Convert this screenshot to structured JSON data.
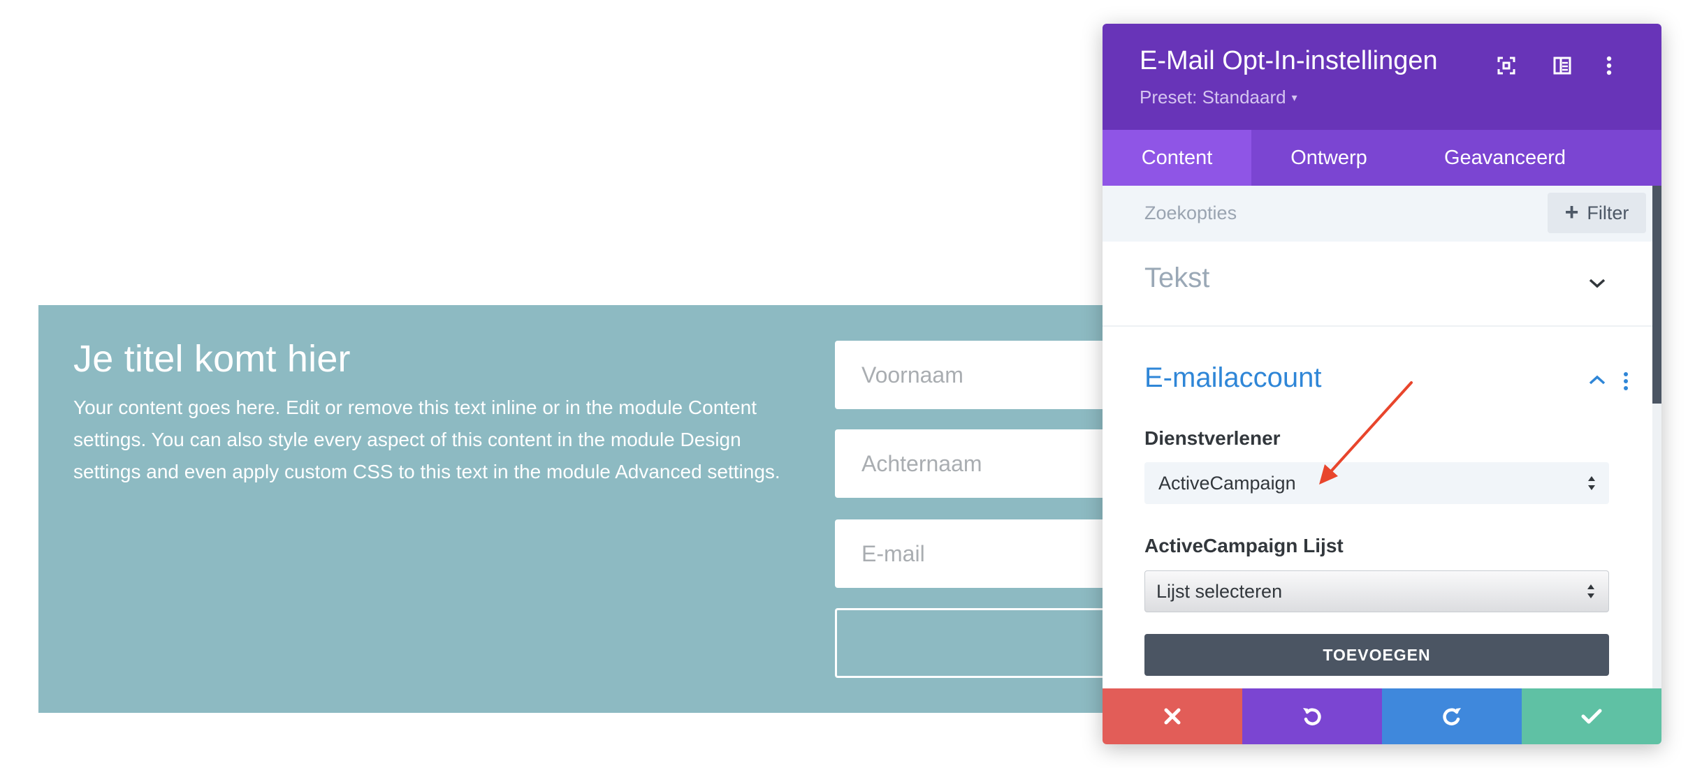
{
  "module": {
    "title": "Je titel komt hier",
    "body": "Your content goes here. Edit or remove this text inline or in the module Content settings. You can also style every aspect of this content in the module Design settings and even apply custom CSS to this text in the module Advanced settings.",
    "fields": {
      "first_name": "Voornaam",
      "last_name": "Achternaam",
      "email": "E-mail"
    }
  },
  "panel": {
    "title": "E-Mail Opt-In-instellingen",
    "preset": "Preset: Standaard",
    "header_icons": [
      "expand-icon",
      "layout-icon",
      "more-vertical-icon"
    ],
    "tabs": [
      {
        "label": "Content",
        "active": true
      },
      {
        "label": "Ontwerp",
        "active": false
      },
      {
        "label": "Geavanceerd",
        "active": false
      }
    ],
    "search": {
      "placeholder": "Zoekopties",
      "filter_label": "Filter"
    },
    "sections": {
      "tekst": {
        "label": "Tekst",
        "expanded": false
      },
      "email_account": {
        "label": "E-mailaccount",
        "expanded": true,
        "provider_label": "Dienstverlener",
        "provider_value": "ActiveCampaign",
        "list_label": "ActiveCampaign Lijst",
        "list_value": "Lijst selecteren",
        "add_button": "TOEVOEGEN"
      }
    },
    "footer": [
      "close-icon",
      "undo-icon",
      "redo-icon",
      "check-icon"
    ]
  },
  "colors": {
    "section_bg": "#8dbac2",
    "header_purple": "#6834b8",
    "tab_purple": "#7b45d2",
    "accent_blue": "#2f86d7",
    "annotation_red": "#e8452c",
    "cancel_red": "#e25d58",
    "redo_blue": "#3f88dc",
    "save_green": "#5fc1a4"
  }
}
